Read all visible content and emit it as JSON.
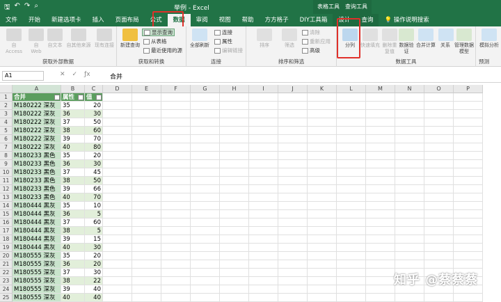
{
  "window": {
    "title": "举例  -  Excel",
    "context_groups": [
      "表格工具",
      "查询工具"
    ]
  },
  "tabs": [
    "文件",
    "开始",
    "新建选项卡",
    "插入",
    "页面布局",
    "公式",
    "数据",
    "审阅",
    "视图",
    "帮助",
    "方方格子",
    "DIY工具箱",
    "设计",
    "查询",
    "操作说明搜索"
  ],
  "ribbon": {
    "get_external": {
      "label": "获取外部数据",
      "buttons": [
        "自 Access",
        "自 Web",
        "自文本",
        "自其他来源",
        "现有连接"
      ]
    },
    "get_transform": {
      "label": "获取和转换",
      "new_query": "新建查询",
      "small": [
        "显示查询",
        "从表格",
        "最近使用的源"
      ]
    },
    "connections": {
      "label": "连接",
      "refresh_all": "全部刷新",
      "small": [
        "连接",
        "属性",
        "编辑链接"
      ]
    },
    "sort_filter": {
      "label": "排序和筛选",
      "sort": "排序",
      "filter": "筛选",
      "small": [
        "清除",
        "重新应用",
        "高级"
      ]
    },
    "data_tools": {
      "label": "数据工具",
      "buttons": [
        "分列",
        "快速填充",
        "删除重复值",
        "数据验证",
        "合并计算",
        "关系",
        "管理数据模型"
      ]
    },
    "forecast": {
      "buttons": [
        "模拟分析"
      ],
      "label": "预测"
    }
  },
  "formula_bar": {
    "name_box": "A1",
    "formula": "合并"
  },
  "columns": [
    "A",
    "B",
    "C",
    "D",
    "E",
    "F",
    "G",
    "H",
    "I",
    "J",
    "K",
    "L",
    "M",
    "N",
    "O",
    "P"
  ],
  "table": {
    "headers": [
      "合并",
      "属性",
      "值"
    ],
    "rows": [
      [
        "M180222 深灰",
        "35",
        "20"
      ],
      [
        "M180222 深灰",
        "36",
        "30"
      ],
      [
        "M180222 深灰",
        "37",
        "50"
      ],
      [
        "M180222 深灰",
        "38",
        "60"
      ],
      [
        "M180222 深灰",
        "39",
        "70"
      ],
      [
        "M180222 深灰",
        "40",
        "80"
      ],
      [
        "M180233 黑色",
        "35",
        "20"
      ],
      [
        "M180233 黑色",
        "36",
        "30"
      ],
      [
        "M180233 黑色",
        "37",
        "45"
      ],
      [
        "M180233 黑色",
        "38",
        "50"
      ],
      [
        "M180233 黑色",
        "39",
        "66"
      ],
      [
        "M180233 黑色",
        "40",
        "70"
      ],
      [
        "M180444 黑灰",
        "35",
        "10"
      ],
      [
        "M180444 黑灰",
        "36",
        "5"
      ],
      [
        "M180444 黑灰",
        "37",
        "60"
      ],
      [
        "M180444 黑灰",
        "38",
        "5"
      ],
      [
        "M180444 黑灰",
        "39",
        "15"
      ],
      [
        "M180444 黑灰",
        "40",
        "30"
      ],
      [
        "M180555 深灰",
        "35",
        "20"
      ],
      [
        "M180555 深灰",
        "36",
        "20"
      ],
      [
        "M180555 深灰",
        "37",
        "30"
      ],
      [
        "M180555 深灰",
        "38",
        "22"
      ],
      [
        "M180555 深灰",
        "39",
        "40"
      ],
      [
        "M180555 深灰",
        "40",
        "40"
      ]
    ]
  },
  "watermark": "知乎 @蔡蔡蔡",
  "colors": {
    "excel_green": "#217346",
    "table_header": "#5b9e5e",
    "band": "#e2efda",
    "highlight": "#e0302a"
  }
}
